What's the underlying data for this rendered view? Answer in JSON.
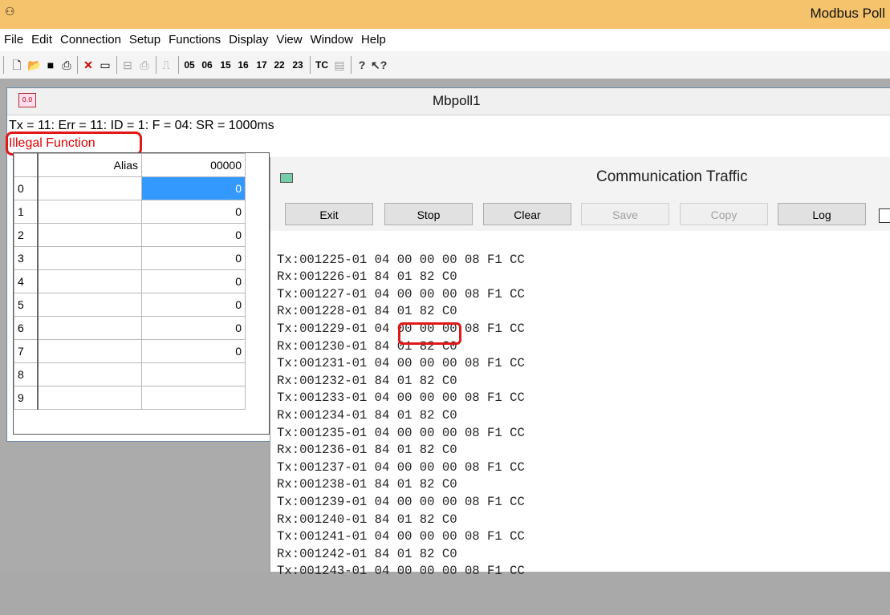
{
  "app": {
    "title": "Modbus Poll",
    "icon": "modbus-app-icon"
  },
  "menu": [
    "File",
    "Edit",
    "Connection",
    "Setup",
    "Functions",
    "Display",
    "View",
    "Window",
    "Help"
  ],
  "toolbar": {
    "icons": [
      "new-icon",
      "open-icon",
      "save-icon",
      "print-icon",
      "disconnect-icon",
      "window-icon",
      "read-write-icon",
      "print-preview-icon",
      "pulse-icon"
    ],
    "function_codes": [
      "05",
      "06",
      "15",
      "16",
      "17",
      "22",
      "23"
    ],
    "tc_label": "TC",
    "extra_icons": [
      "traffic-icon",
      "about-icon",
      "context-help-icon"
    ]
  },
  "child": {
    "title": "Mbpoll1",
    "status_line": "Tx = 11: Err = 11: ID = 1: F = 04: SR = 1000ms",
    "error_text": "Illegal Function",
    "grid": {
      "alias_header": "Alias",
      "address_header": "00000",
      "rows": [
        {
          "index": "0",
          "value": "0"
        },
        {
          "index": "1",
          "value": "0"
        },
        {
          "index": "2",
          "value": "0"
        },
        {
          "index": "3",
          "value": "0"
        },
        {
          "index": "4",
          "value": "0"
        },
        {
          "index": "5",
          "value": "0"
        },
        {
          "index": "6",
          "value": "0"
        },
        {
          "index": "7",
          "value": "0"
        },
        {
          "index": "8",
          "value": ""
        },
        {
          "index": "9",
          "value": ""
        }
      ]
    }
  },
  "traffic": {
    "title": "Communication Traffic",
    "buttons": {
      "exit": "Exit",
      "stop": "Stop",
      "clear": "Clear",
      "save": "Save",
      "copy": "Copy",
      "log": "Log"
    },
    "lines": [
      "Tx:001225-01 04 00 00 00 08 F1 CC",
      "Rx:001226-01 84 01 82 C0",
      "Tx:001227-01 04 00 00 00 08 F1 CC",
      "Rx:001228-01 84 01 82 C0",
      "Tx:001229-01 04 00 00 00 08 F1 CC",
      "Rx:001230-01 84 01 82 C0",
      "Tx:001231-01 04 00 00 00 08 F1 CC",
      "Rx:001232-01 84 01 82 C0",
      "Tx:001233-01 04 00 00 00 08 F1 CC",
      "Rx:001234-01 84 01 82 C0",
      "Tx:001235-01 04 00 00 00 08 F1 CC",
      "Rx:001236-01 84 01 82 C0",
      "Tx:001237-01 04 00 00 00 08 F1 CC",
      "Rx:001238-01 84 01 82 C0",
      "Tx:001239-01 04 00 00 00 08 F1 CC",
      "Rx:001240-01 84 01 82 C0",
      "Tx:001241-01 04 00 00 00 08 F1 CC",
      "Rx:001242-01 84 01 82 C0",
      "Tx:001243-01 04 00 00 00 08 F1 CC"
    ]
  },
  "colors": {
    "titlebar": "#f5c36c",
    "error_text": "#e00000",
    "highlight": "#e01818",
    "selection": "#3399ff"
  }
}
